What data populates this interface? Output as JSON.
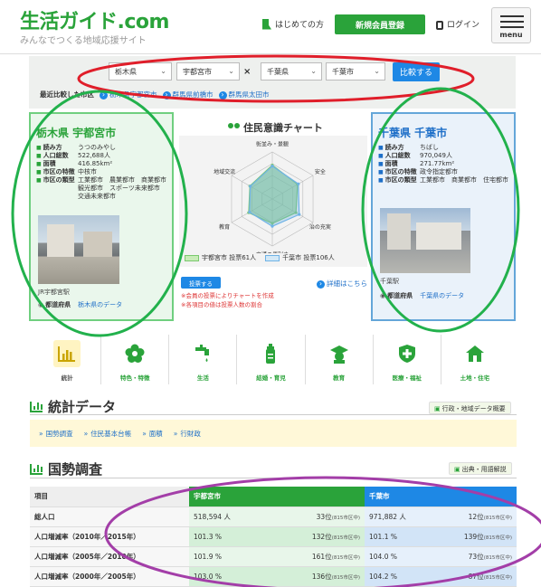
{
  "header": {
    "logo": "生活ガイド.com",
    "tagline": "みんなでつくる地域応援サイト",
    "first_time": "はじめての方",
    "register": "新規会員登録",
    "login": "ログイン",
    "menu": "menu"
  },
  "compare": {
    "pref_a": "栃木県",
    "city_a": "宇都宮市",
    "cross": "×",
    "pref_b": "千葉県",
    "city_b": "千葉市",
    "button": "比較する",
    "recent_label": "最近比較した市区",
    "recent_1": "栃木県宇都宮市",
    "recent_2": "群馬県前橋市",
    "recent_3": "群馬県太田市"
  },
  "city_a": {
    "title": "栃木県 宇都宮市",
    "reading_label": "読み方",
    "reading": "うつのみやし",
    "pop_label": "人口総数",
    "pop": "522,688人",
    "area_label": "面積",
    "area": "416.85km²",
    "feature_label": "市区の特徴",
    "feature": "中核市",
    "type_label": "市区の類型",
    "type": "工業都市　農業都市　商業都市　観光都市　スポーツ未来都市　交通未来都市",
    "photo_caption": "JR宇都宮駅",
    "pref_label": "都道府県",
    "pref_link": "栃木県のデータ"
  },
  "city_b": {
    "title": "千葉県 千葉市",
    "reading_label": "読み方",
    "reading": "ちばし",
    "pop_label": "人口総数",
    "pop": "970,049人",
    "area_label": "面積",
    "area": "271.77km²",
    "feature_label": "市区の特徴",
    "feature": "政令指定都市",
    "type_label": "市区の類型",
    "type": "工業都市　商業都市　住宅都市",
    "photo_caption": "千葉駅",
    "pref_label": "都道府県",
    "pref_link": "千葉県のデータ"
  },
  "radar": {
    "title": "住民意識チャート",
    "axes": [
      "街並み・景観",
      "安全",
      "治の充実",
      "交通の便利さ",
      "教育",
      "地域交流"
    ],
    "series": [
      {
        "name": "宇都宮市 投票61人",
        "values": [
          0.72,
          0.62,
          0.58,
          0.52,
          0.58,
          0.55
        ],
        "color": "#7ac96e"
      },
      {
        "name": "千葉市 投票106人",
        "values": [
          0.7,
          0.64,
          0.66,
          0.58,
          0.56,
          0.54
        ],
        "color": "#6fb3e6"
      }
    ],
    "vote_btn": "投票する",
    "detail": "詳細はこちら",
    "note1": "※会員の投票によりチャートを作成",
    "note2": "※各項目の値は投票人数の割合"
  },
  "categories": [
    {
      "label": "統計",
      "icon": "bar-chart-icon",
      "color": "#2aa33a"
    },
    {
      "label": "特色・特徴",
      "icon": "flower-icon",
      "color": "#2aa33a"
    },
    {
      "label": "生活",
      "icon": "faucet-icon",
      "color": "#2aa33a"
    },
    {
      "label": "結婚・育児",
      "icon": "baby-bottle-icon",
      "color": "#2aa33a"
    },
    {
      "label": "教育",
      "icon": "graduation-icon",
      "color": "#2aa33a"
    },
    {
      "label": "医療・福祉",
      "icon": "medical-cross-icon",
      "color": "#2aa33a"
    },
    {
      "label": "土地・住宅",
      "icon": "house-icon",
      "color": "#2aa33a"
    }
  ],
  "stats": {
    "title": "統計データ",
    "tag": "行政・地域データ概要",
    "links": [
      "国勢調査",
      "住民基本台帳",
      "面積",
      "行財政"
    ]
  },
  "census": {
    "title": "国勢調査",
    "tag": "出典・用語解説",
    "head_item": "項目",
    "head_a": "宇都宮市",
    "head_b": "千葉市",
    "rows": [
      {
        "item": "総人口",
        "a_val": "518,594 人",
        "a_rank": "33位",
        "a_of": "(815市区中)",
        "b_val": "971,882 人",
        "b_rank": "12位",
        "b_of": "(815市区中)"
      },
      {
        "item": "人口増減率（2010年／2015年）",
        "a_val": "101.3 %",
        "a_rank": "132位",
        "a_of": "(815市区中)",
        "b_val": "101.1 %",
        "b_rank": "139位",
        "b_of": "(815市区中)"
      },
      {
        "item": "人口増減率（2005年／2010年）",
        "a_val": "101.9 %",
        "a_rank": "161位",
        "a_of": "(815市区中)",
        "b_val": "104.0 %",
        "b_rank": "73位",
        "b_of": "(815市区中)"
      },
      {
        "item": "人口増減率（2000年／2005年）",
        "a_val": "103.0 %",
        "a_rank": "136位",
        "a_of": "(815市区中)",
        "b_val": "104.2 %",
        "b_rank": "87位",
        "b_of": "(815市区中)"
      }
    ]
  }
}
